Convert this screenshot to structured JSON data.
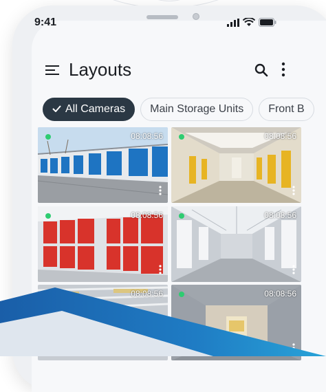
{
  "status_bar": {
    "time": "9:41"
  },
  "header": {
    "title": "Layouts"
  },
  "chips": [
    {
      "label": "All Cameras",
      "active": true
    },
    {
      "label": "Main Storage Units",
      "active": false
    },
    {
      "label": "Front B",
      "active": false
    }
  ],
  "cameras": [
    {
      "timestamp": "08:08:56",
      "scene": "outdoor-blue-units"
    },
    {
      "timestamp": "08:08:56",
      "scene": "indoor-yellow-hallway"
    },
    {
      "timestamp": "08:08:56",
      "scene": "indoor-red-lockers"
    },
    {
      "timestamp": "08:08:56",
      "scene": "indoor-grey-corridor"
    },
    {
      "timestamp": "08:08:56",
      "scene": "indoor-ceiling-racks"
    },
    {
      "timestamp": "08:08:56",
      "scene": "indoor-open-unit"
    }
  ],
  "colors": {
    "accent_dark": "#2b3844",
    "live_indicator": "#2ecc71",
    "swoosh_blue": "#1c6fb8",
    "swoosh_light": "#dfe7ef"
  }
}
